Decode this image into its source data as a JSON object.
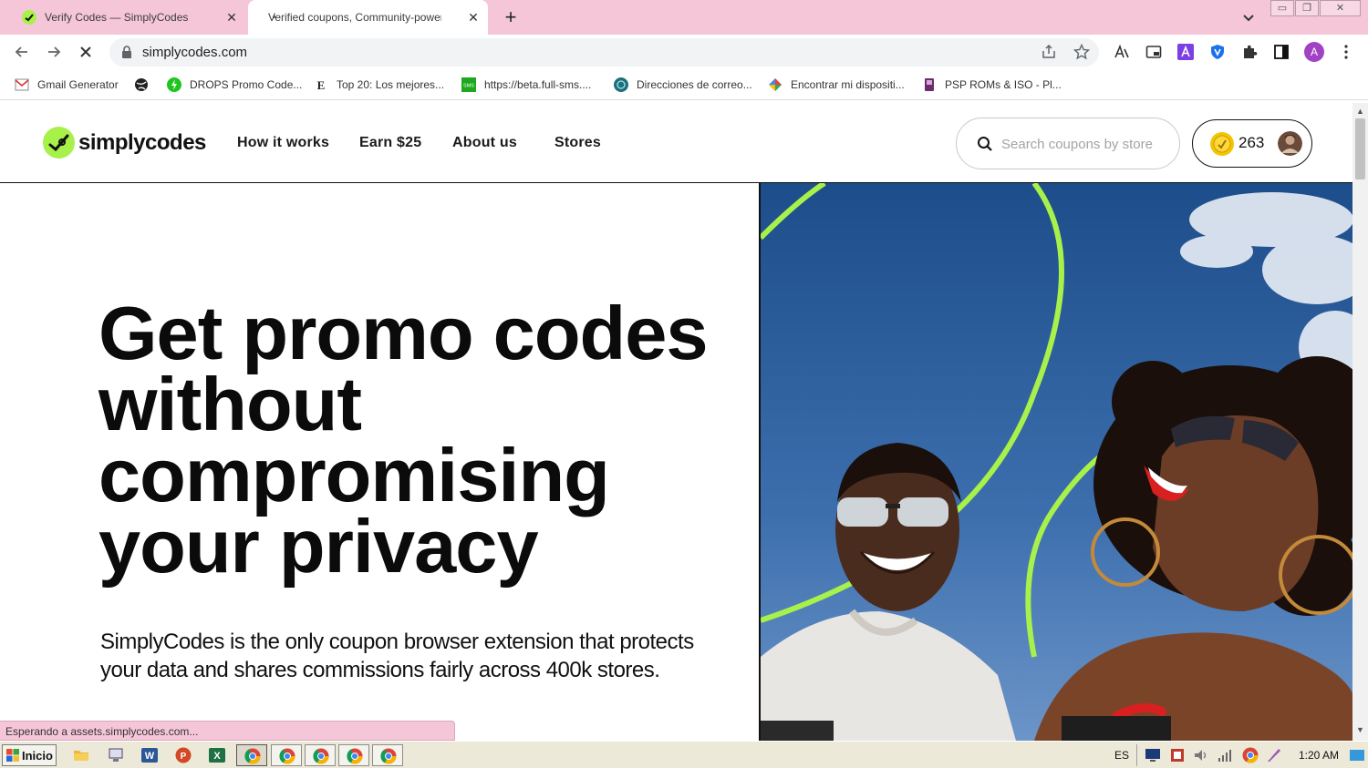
{
  "browser": {
    "tabs": [
      {
        "title": "Verify Codes — SimplyCodes",
        "icon": "simplycodes-favicon"
      },
      {
        "title": "Verified coupons, Community-powered",
        "icon": "loading-dot"
      }
    ],
    "url": "simplycodes.com",
    "status_text": "Esperando a assets.simplycodes.com..."
  },
  "bookmarks": [
    {
      "label": "Gmail Generator",
      "icon": "gmail-generator-icon"
    },
    {
      "label": "",
      "icon": "globe-icon"
    },
    {
      "label": "DROPS Promo Code...",
      "icon": "drops-icon"
    },
    {
      "label": "Top 20: Los mejores...",
      "icon": "e-letter-icon"
    },
    {
      "label": "https://beta.full-sms....",
      "icon": "sms-icon"
    },
    {
      "label": "Direcciones de correo...",
      "icon": "mail-globe-icon"
    },
    {
      "label": "Encontrar mi dispositi...",
      "icon": "find-device-icon"
    },
    {
      "label": "PSP ROMs & ISO - Pl...",
      "icon": "psp-icon"
    }
  ],
  "site": {
    "brand": "simplycodes",
    "nav": [
      "How it works",
      "Earn $25",
      "About us",
      "Stores"
    ],
    "search_placeholder": "Search coupons by store",
    "points": "263",
    "headline": "Get promo codes without compromising your privacy",
    "subheadline": "SimplyCodes is the only coupon browser extension that protects your data and shares commissions fairly across 400k stores.",
    "colors": {
      "brand_green": "#a7f14a",
      "text": "#0b0b0b"
    }
  },
  "taskbar": {
    "start_label": "Inicio",
    "language": "ES",
    "time": "1:20 AM"
  }
}
